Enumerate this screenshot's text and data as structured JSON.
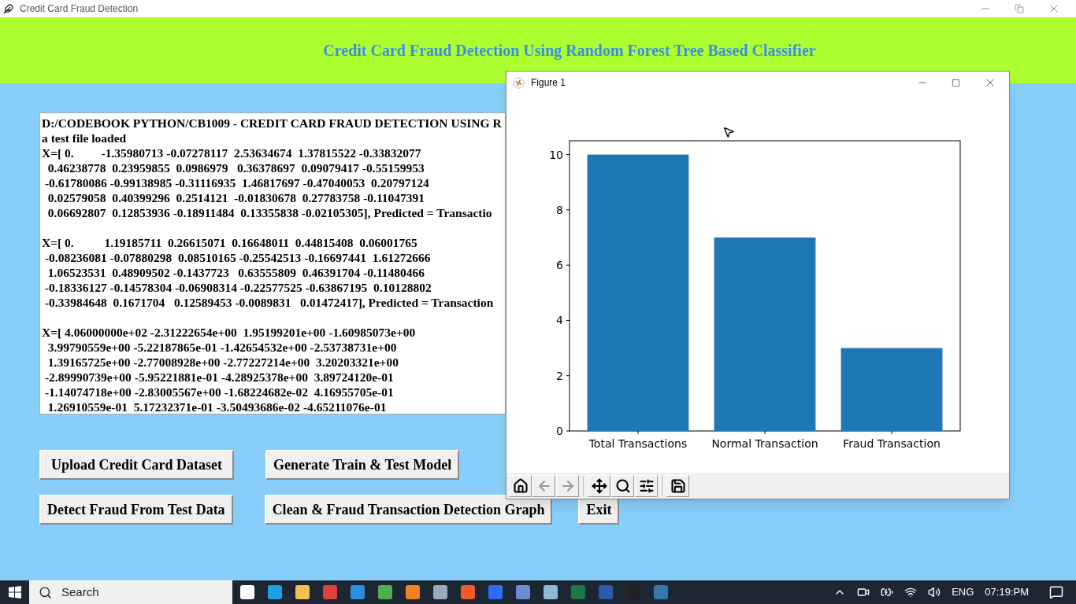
{
  "app_window": {
    "title": "Credit Card Fraud Detection",
    "header": "Credit Card Fraud Detection Using Random Forest Tree Based Classifier",
    "output_blocks": [
      [
        "D:/CODEBOOK PYTHON/CB1009 - CREDIT CARD FRAUD DETECTION USING R",
        "a test file loaded",
        "X=[ 0.         -1.35980713 -0.07278117  2.53634674  1.37815522 -0.33832077",
        "  0.46238778  0.23959855  0.0986979   0.36378697  0.09079417 -0.55159953",
        " -0.61780086 -0.99138985 -0.31116935  1.46817697 -0.47040053  0.20797124",
        "  0.02579058  0.40399296  0.2514121  -0.01830678  0.27783758 -0.11047391",
        "  0.06692807  0.12853936 -0.18911484  0.13355838 -0.02105305], Predicted = Transactio"
      ],
      [
        "X=[ 0.          1.19185711  0.26615071  0.16648011  0.44815408  0.06001765",
        " -0.08236081 -0.07880298  0.08510165 -0.25542513 -0.16697441  1.61272666",
        "  1.06523531  0.48909502 -0.1437723   0.63555809  0.46391704 -0.11480466",
        " -0.18336127 -0.14578304 -0.06908314 -0.22577525 -0.63867195  0.10128802",
        " -0.33984648  0.1671704   0.12589453 -0.0089831   0.01472417], Predicted = Transaction"
      ],
      [
        "X=[ 4.06000000e+02 -2.31222654e+00  1.95199201e+00 -1.60985073e+00",
        "  3.99790559e+00 -5.22187865e-01 -1.42654532e+00 -2.53738731e+00",
        "  1.39165725e+00 -2.77008928e+00 -2.77227214e+00  3.20203321e+00",
        " -2.89990739e+00 -5.95221881e-01 -4.28925378e+00  3.89724120e-01",
        " -1.14074718e+00 -2.83005567e+00 -1.68224682e-02  4.16955705e-01",
        "  1.26910559e-01  5.17232371e-01 -3.50493686e-02 -4.65211076e-01"
      ]
    ],
    "buttons": [
      [
        "Upload Credit Card Dataset",
        "Generate Train & Test Model"
      ],
      [
        "Detect Fraud From Test Data",
        "Clean & Fraud Transaction Detection Graph",
        "Exit"
      ]
    ]
  },
  "figure_window": {
    "title": "Figure 1",
    "chart_data": {
      "type": "bar",
      "categories": [
        "Total Transactions",
        "Normal Transaction",
        "Fraud Transaction"
      ],
      "series": [
        {
          "color": "#1f77b4",
          "values": [
            10,
            7,
            3
          ]
        }
      ],
      "ylim": [
        0,
        10.5
      ],
      "yticks": [
        0,
        2,
        4,
        6,
        8,
        10
      ]
    }
  },
  "taskbar": {
    "search_placeholder": "Search",
    "tray": {
      "language": "ENG",
      "time": "07:19:PM"
    }
  }
}
